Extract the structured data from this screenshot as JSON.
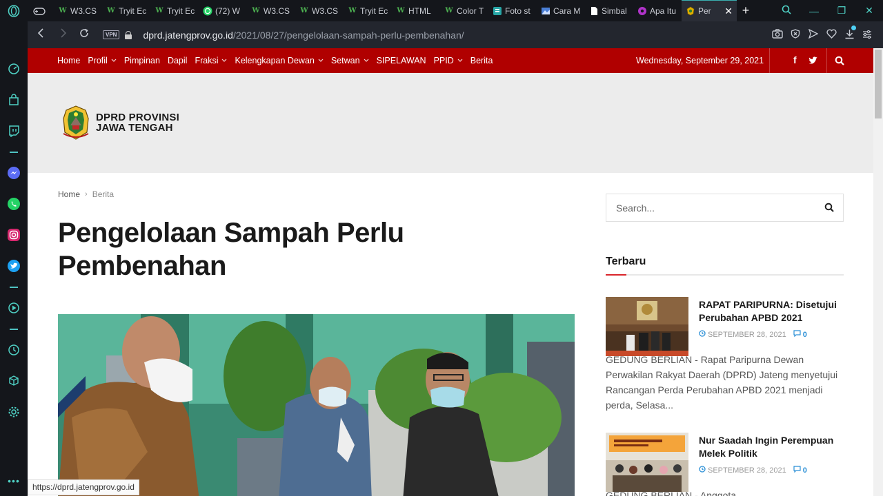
{
  "browser": {
    "tabs": [
      {
        "label": "",
        "icon": "gamepad-icon",
        "color": "#c9ccd3"
      },
      {
        "label": "W3.CS",
        "icon": "w3-icon",
        "color": "#4caf50"
      },
      {
        "label": "Tryit Ec",
        "icon": "w3-icon",
        "color": "#4caf50"
      },
      {
        "label": "Tryit Ec",
        "icon": "w3-icon",
        "color": "#4caf50"
      },
      {
        "label": "(72) W",
        "icon": "whatsapp-icon",
        "color": "#25d366"
      },
      {
        "label": "W3.CS",
        "icon": "w3-icon",
        "color": "#4caf50"
      },
      {
        "label": "W3.CS",
        "icon": "w3-icon",
        "color": "#4caf50"
      },
      {
        "label": "Tryit Ec",
        "icon": "w3-icon",
        "color": "#4caf50"
      },
      {
        "label": "HTML",
        "icon": "w3-icon",
        "color": "#4caf50"
      },
      {
        "label": "Color T",
        "icon": "w3-icon",
        "color": "#4caf50"
      },
      {
        "label": "Foto st",
        "icon": "doc-icon",
        "color": "#27a6a6"
      },
      {
        "label": "Cara M",
        "icon": "image-icon",
        "color": "#4a7fd6"
      },
      {
        "label": "Simbal",
        "icon": "file-icon",
        "color": "#ffffff"
      },
      {
        "label": "Apa Itu",
        "icon": "circle-icon",
        "color": "#b033c9"
      }
    ],
    "active_tab": {
      "label": "Per",
      "icon": "emblem-icon"
    },
    "url_host": "dprd.jatengprov.go.id",
    "url_path": "/2021/08/27/pengelolaan-sampah-perlu-pembenahan/",
    "vpn_label": "VPN",
    "status_url": "https://dprd.jatengprov.go.id"
  },
  "site": {
    "nav": [
      {
        "label": "Home",
        "dropdown": false
      },
      {
        "label": "Profil",
        "dropdown": true
      },
      {
        "label": "Pimpinan",
        "dropdown": false
      },
      {
        "label": "Dapil",
        "dropdown": false
      },
      {
        "label": "Fraksi",
        "dropdown": true
      },
      {
        "label": "Kelengkapan Dewan",
        "dropdown": true
      },
      {
        "label": "Setwan",
        "dropdown": true
      },
      {
        "label": "SIPELAWAN",
        "dropdown": false
      },
      {
        "label": "PPID",
        "dropdown": true
      },
      {
        "label": "Berita",
        "dropdown": false
      }
    ],
    "date": "Wednesday, September 29, 2021",
    "logo_line1": "DPRD PROVINSI",
    "logo_line2": "JAWA TENGAH",
    "brand_color": "#b00000"
  },
  "breadcrumb": {
    "home": "Home",
    "current": "Berita"
  },
  "article": {
    "title": "Pengelolaan Sampah Perlu Pembenahan"
  },
  "sidebar": {
    "search_placeholder": "Search...",
    "widget_title": "Terbaru",
    "posts": [
      {
        "title": "RAPAT PARIPURNA: Disetujui Perubahan APBD 2021",
        "date": "SEPTEMBER 28, 2021",
        "comments": "0",
        "excerpt": "GEDUNG BERLIAN - Rapat Paripurna Dewan Perwakilan Rakyat Daerah (DPRD) Jateng menyetujui Rancangan Perda Perubahan APBD 2021 menjadi perda, Selasa..."
      },
      {
        "title": "Nur Saadah Ingin Perempuan Melek Politik",
        "date": "SEPTEMBER 28, 2021",
        "comments": "0",
        "excerpt": "GEDUNG BERLIAN - Anggota"
      }
    ]
  }
}
